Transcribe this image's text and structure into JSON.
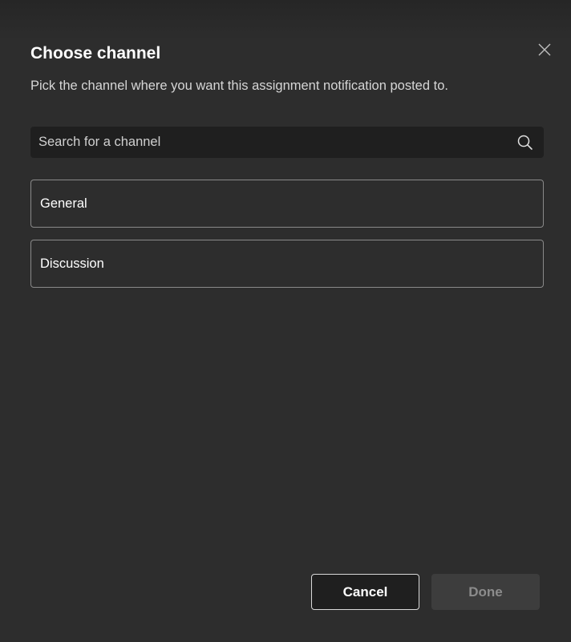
{
  "dialog": {
    "title": "Choose channel",
    "subtitle": "Pick the channel where you want this assignment notification posted to.",
    "close_icon": "close-icon"
  },
  "search": {
    "placeholder": "Search for a channel",
    "value": "",
    "icon": "search-icon"
  },
  "channels": [
    {
      "label": "General"
    },
    {
      "label": "Discussion"
    }
  ],
  "footer": {
    "cancel_label": "Cancel",
    "done_label": "Done",
    "done_disabled": true
  },
  "colors": {
    "background": "#2d2d2d",
    "input_background": "#1f1f1f",
    "border": "#8a8a8a",
    "text_primary": "#ffffff",
    "text_secondary": "#d6d6d6",
    "disabled_button_bg": "#3d3d3d",
    "disabled_button_text": "#8c8c8c"
  }
}
